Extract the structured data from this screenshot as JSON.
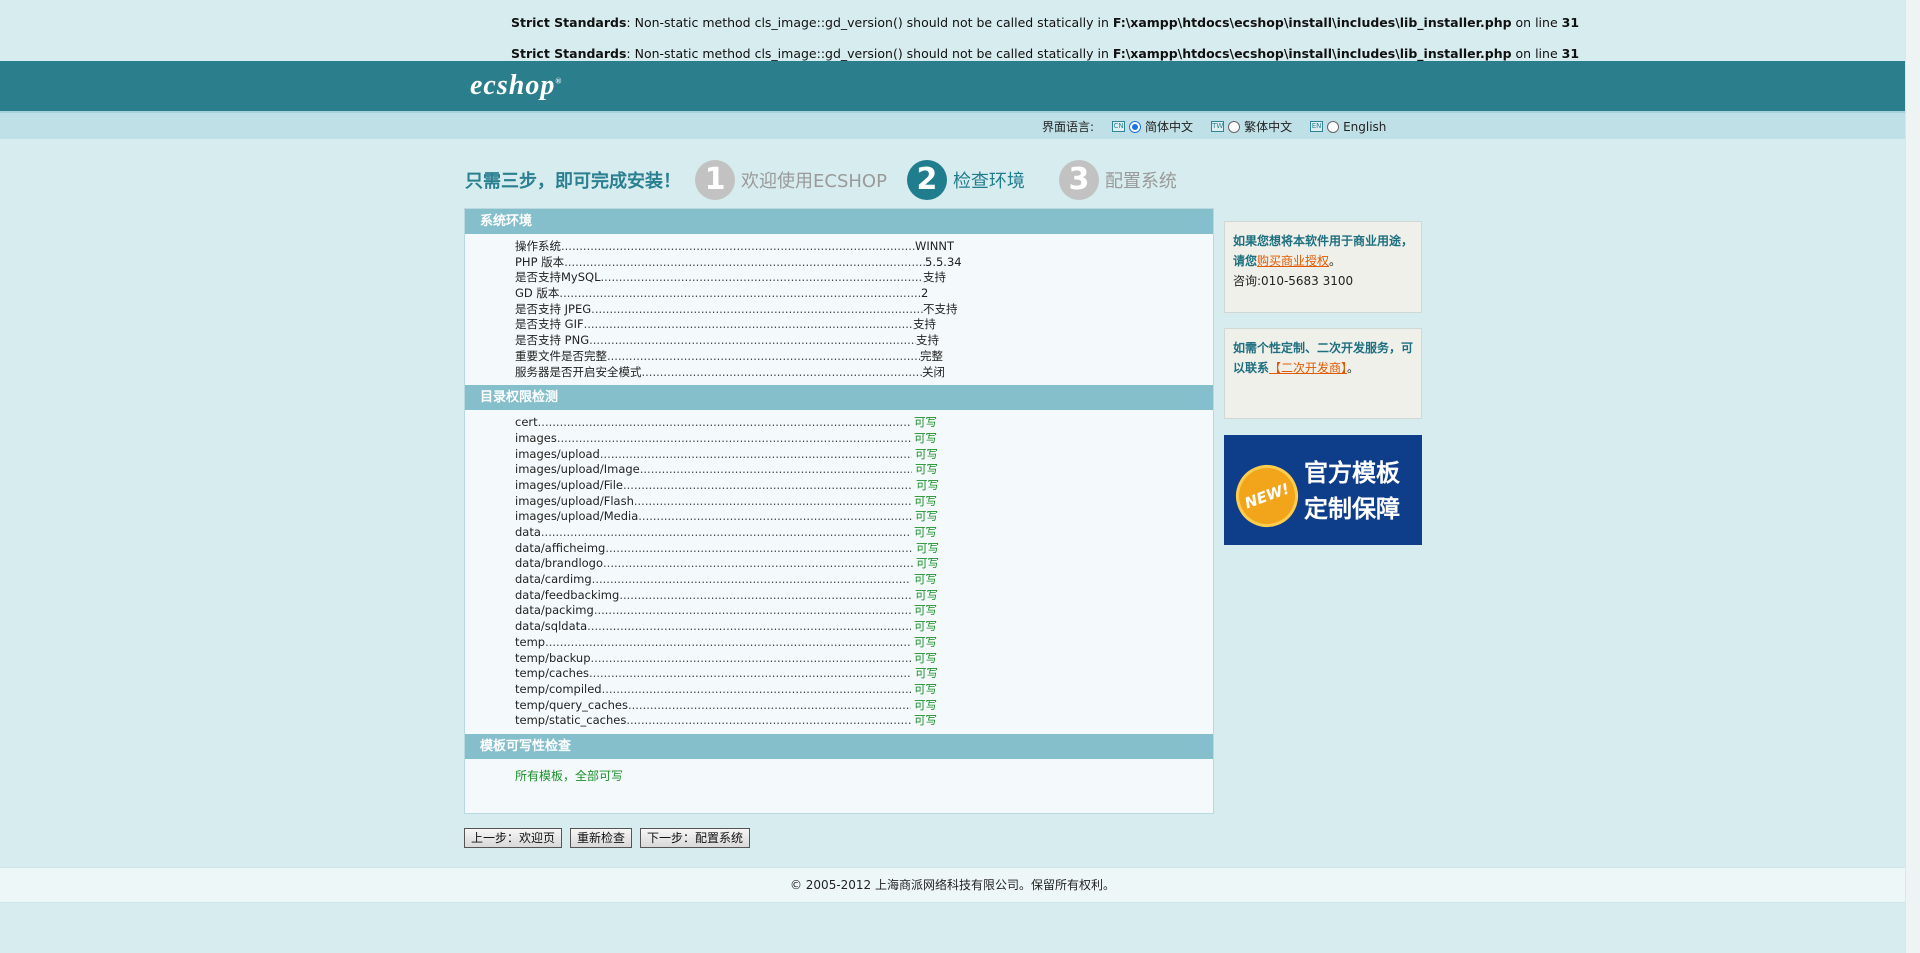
{
  "warnings": [
    {
      "label": "Strict Standards",
      "message": ": Non-static method cls_image::gd_version() should not be called statically in ",
      "path": "F:\\xampp\\htdocs\\ecshop\\install\\includes\\lib_installer.php",
      "on_line": " on line ",
      "line": "31"
    },
    {
      "label": "Strict Standards",
      "message": ": Non-static method cls_image::gd_version() should not be called statically in ",
      "path": "F:\\xampp\\htdocs\\ecshop\\install\\includes\\lib_installer.php",
      "on_line": " on line ",
      "line": "31"
    }
  ],
  "header": {
    "logo_text": "ecshop"
  },
  "language": {
    "label": "界面语言:",
    "options": [
      {
        "flag": "CN",
        "label": "简体中文",
        "selected": true
      },
      {
        "flag": "TW",
        "label": "繁体中文",
        "selected": false
      },
      {
        "flag": "EN",
        "label": "English",
        "selected": false
      }
    ]
  },
  "steps": {
    "intro": "只需三步，即可完成安装！",
    "items": [
      {
        "num": "1",
        "label": "欢迎使用ECSHOP"
      },
      {
        "num": "2",
        "label": "检查环境"
      },
      {
        "num": "3",
        "label": "配置系统"
      }
    ]
  },
  "system_env": {
    "title": "系统环境",
    "rows": [
      {
        "name": "操作系统",
        "value": "WINNT"
      },
      {
        "name": "PHP 版本",
        "value": "5.5.34"
      },
      {
        "name": "是否支持MySQL",
        "value": "支持"
      },
      {
        "name": "GD 版本",
        "value": "2"
      },
      {
        "name": "是否支持 JPEG",
        "value": "不支持"
      },
      {
        "name": "是否支持 GIF",
        "value": "支持"
      },
      {
        "name": "是否支持 PNG",
        "value": "支持"
      },
      {
        "name": "重要文件是否完整",
        "value": "完整"
      },
      {
        "name": "服务器是否开启安全模式",
        "value": "关闭"
      }
    ]
  },
  "dir_perms": {
    "title": "目录权限检测",
    "rows": [
      {
        "name": "cert",
        "value": "可写"
      },
      {
        "name": "images",
        "value": "可写"
      },
      {
        "name": "images/upload",
        "value": "可写"
      },
      {
        "name": "images/upload/Image",
        "value": "可写"
      },
      {
        "name": "images/upload/File",
        "value": "可写"
      },
      {
        "name": "images/upload/Flash",
        "value": "可写"
      },
      {
        "name": "images/upload/Media",
        "value": "可写"
      },
      {
        "name": "data",
        "value": "可写"
      },
      {
        "name": "data/afficheimg",
        "value": "可写"
      },
      {
        "name": "data/brandlogo",
        "value": "可写"
      },
      {
        "name": "data/cardimg",
        "value": "可写"
      },
      {
        "name": "data/feedbackimg",
        "value": "可写"
      },
      {
        "name": "data/packimg",
        "value": "可写"
      },
      {
        "name": "data/sqldata",
        "value": "可写"
      },
      {
        "name": "temp",
        "value": "可写"
      },
      {
        "name": "temp/backup",
        "value": "可写"
      },
      {
        "name": "temp/caches",
        "value": "可写"
      },
      {
        "name": "temp/compiled",
        "value": "可写"
      },
      {
        "name": "temp/query_caches",
        "value": "可写"
      },
      {
        "name": "temp/static_caches",
        "value": "可写"
      }
    ]
  },
  "template_check": {
    "title": "模板可写性检查",
    "result": "所有模板，全部可写"
  },
  "sidebar": {
    "box1": {
      "line1": "如果您想将本软件用于商业用途，请您",
      "link": "购买商业授权",
      "line1_end": "。",
      "contact": "咨询:010-5683 3100"
    },
    "box2": {
      "line1": "如需个性定制、二次开发服务，可以联系",
      "link": "【二次开发商】",
      "line1_end": "。"
    },
    "banner": {
      "badge": "NEW!",
      "line1": "官方模板",
      "line2": "定制保障"
    }
  },
  "buttons": {
    "prev": "上一步：欢迎页",
    "recheck": "重新检查",
    "next": "下一步：配置系统"
  },
  "footer": {
    "text": "© 2005-2012 上海商派网络科技有限公司。保留所有权利。"
  },
  "colors": {
    "header": "#2b7e8c",
    "section": "#85bfcc",
    "ok": "#1a8f2a",
    "accent": "#1f7d8d"
  }
}
